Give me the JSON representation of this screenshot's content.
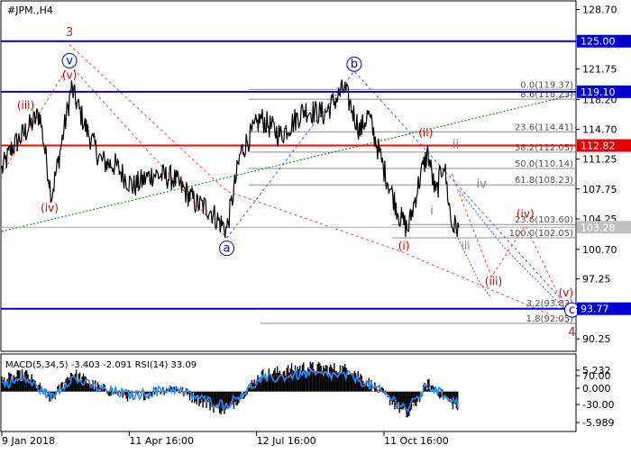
{
  "chart_data": [
    {
      "type": "line",
      "title": "#JPM.,H4",
      "ylim": [
        88.9,
        129.6
      ],
      "yticks": [
        128.7,
        125.0,
        121.75,
        118.2,
        114.7,
        111.25,
        107.75,
        104.25,
        100.7,
        97.25,
        93.8,
        90.25
      ],
      "ytick_labels": [
        "128.70",
        "125.00",
        "121.75",
        "118.20",
        "114.70",
        "111.25",
        "107.75",
        "104.25",
        "100.70",
        "97.25",
        "93.80",
        "90.25"
      ],
      "xticks": [
        {
          "label": "9 Jan 2018",
          "bar": 0
        },
        {
          "label": "11 Apr 16:00",
          "bar": 320
        },
        {
          "label": "12 Jul 16:00",
          "bar": 640
        },
        {
          "label": "11 Oct 16:00",
          "bar": 960
        }
      ],
      "bars_total": 1150,
      "grid": false,
      "series": [
        {
          "color": "#000000",
          "anchors": [
            [
              0,
              110.0
            ],
            [
              25,
              112.5
            ],
            [
              60,
              114.5
            ],
            [
              95,
              116.5
            ],
            [
              125,
              107.0
            ],
            [
              140,
              110.5
            ],
            [
              175,
              119.5
            ],
            [
              210,
              115.0
            ],
            [
              250,
              111.0
            ],
            [
              285,
              110.5
            ],
            [
              330,
              108.0
            ],
            [
              380,
              109.5
            ],
            [
              430,
              109.0
            ],
            [
              490,
              106.0
            ],
            [
              520,
              105.5
            ],
            [
              545,
              104.0
            ],
            [
              565,
              103.0
            ],
            [
              600,
              112.0
            ],
            [
              650,
              116.0
            ],
            [
              700,
              114.0
            ],
            [
              760,
              117.0
            ],
            [
              810,
              116.5
            ],
            [
              860,
              119.5
            ],
            [
              900,
              114.5
            ],
            [
              920,
              116.5
            ],
            [
              960,
              110.0
            ],
            [
              1000,
              104.5
            ],
            [
              1020,
              103.0
            ],
            [
              1050,
              109.0
            ],
            [
              1070,
              112.0
            ],
            [
              1090,
              107.0
            ],
            [
              1110,
              111.0
            ],
            [
              1130,
              103.5
            ],
            [
              1148,
              103.28
            ]
          ]
        }
      ],
      "horizontal_lines": [
        {
          "value": 125.0,
          "color": "#0000cc",
          "label": "125.00",
          "label_bg": "#0000cc"
        },
        {
          "value": 119.1,
          "color": "#0000cc",
          "label": "119.10",
          "label_bg": "#0000cc"
        },
        {
          "value": 112.82,
          "color": "#ff0000",
          "label": "112.82",
          "label_bg": "#e00000"
        },
        {
          "value": 103.28,
          "color": "#aaaaaa",
          "label": "103.28",
          "label_bg": "#c0c0c0"
        },
        {
          "value": 93.77,
          "color": "#0000cc",
          "label": "93.77",
          "label_bg": "#0000cc"
        }
      ],
      "fib_levels": [
        {
          "label": "0.0(119.37)",
          "value": 119.37
        },
        {
          "label": "8.6(118.23)",
          "value": 118.23
        },
        {
          "label": "23.6(114.41)",
          "value": 114.41
        },
        {
          "label": "38.2(112.05)",
          "value": 112.05
        },
        {
          "label": "50.0(110.14)",
          "value": 110.14
        },
        {
          "label": "61.8(108.23)",
          "value": 108.23
        },
        {
          "label": "23.6(103.60)",
          "value": 103.6
        },
        {
          "label": "100.0(102.05)",
          "value": 102.05
        },
        {
          "label": "3.2(93.83)",
          "value": 93.83
        },
        {
          "label": "1.8(92.05)",
          "value": 92.05
        }
      ],
      "wave_labels": [
        {
          "text": "3",
          "bar": 170,
          "value": 125.6,
          "color": "#b03030"
        },
        {
          "text": "v",
          "bar": 170,
          "value": 122.3,
          "color": "#0000cc",
          "circled": true
        },
        {
          "text": "(v)",
          "bar": 170,
          "value": 120.6,
          "color": "#cc0000"
        },
        {
          "text": "(iii)",
          "bar": 60,
          "value": 117.1,
          "color": "#cc0000"
        },
        {
          "text": "(iv)",
          "bar": 120,
          "value": 105.1,
          "color": "#cc0000"
        },
        {
          "text": "a",
          "bar": 565,
          "value": 100.4,
          "color": "#0000cc",
          "circled": true
        },
        {
          "text": "b",
          "bar": 885,
          "value": 121.9,
          "color": "#0000cc",
          "circled": true
        },
        {
          "text": "(ii)",
          "bar": 1065,
          "value": 113.9,
          "color": "#cc0000"
        },
        {
          "text": "ii",
          "bar": 1140,
          "value": 112.5,
          "color": "#808080"
        },
        {
          "text": "iv",
          "bar": 1205,
          "value": 107.9,
          "color": "#808080"
        },
        {
          "text": "i",
          "bar": 1080,
          "value": 104.8,
          "color": "#808080"
        },
        {
          "text": "(i)",
          "bar": 1010,
          "value": 100.7,
          "color": "#cc0000"
        },
        {
          "text": "iii",
          "bar": 1165,
          "value": 100.7,
          "color": "#808080"
        },
        {
          "text": "(iii)",
          "bar": 1235,
          "value": 96.5,
          "color": "#cc0000"
        },
        {
          "text": "(iv)",
          "bar": 1315,
          "value": 104.4,
          "color": "#cc0000"
        },
        {
          "text": "(v)",
          "bar": 1417,
          "value": 95.2,
          "color": "#cc0000"
        },
        {
          "text": "c",
          "bar": 1432,
          "value": 93.2,
          "color": "#0000cc",
          "circled": true
        },
        {
          "text": "4",
          "bar": 1432,
          "value": 90.6,
          "color": "#b03030"
        }
      ]
    },
    {
      "type": "line",
      "title": "MACD(5,34,5) -3.403 -2.091 RSI(14) 33.09",
      "ylim": [
        -6.9,
        6.3
      ],
      "yticks": [
        5.232,
        70.0,
        0.0,
        -30.0,
        -5.989
      ],
      "ytick_labels": [
        "5.232",
        "70.00",
        "0.000",
        "-30.00",
        "-5.989"
      ],
      "histogram_color": "#000000",
      "signal_color": "#ff0000",
      "rsi_color": "#1e90ff",
      "histogram_anchors": [
        [
          0,
          2.0
        ],
        [
          60,
          3.2
        ],
        [
          125,
          -1.5
        ],
        [
          175,
          3.5
        ],
        [
          250,
          0.5
        ],
        [
          330,
          -1.0
        ],
        [
          430,
          0.8
        ],
        [
          520,
          -2.5
        ],
        [
          565,
          -3.5
        ],
        [
          650,
          3.0
        ],
        [
          760,
          4.5
        ],
        [
          880,
          4.0
        ],
        [
          960,
          -0.5
        ],
        [
          1020,
          -4.5
        ],
        [
          1070,
          1.5
        ],
        [
          1130,
          -2.0
        ],
        [
          1148,
          -3.403
        ]
      ],
      "signal_value": -2.091,
      "rsi_value": 33.09
    }
  ]
}
